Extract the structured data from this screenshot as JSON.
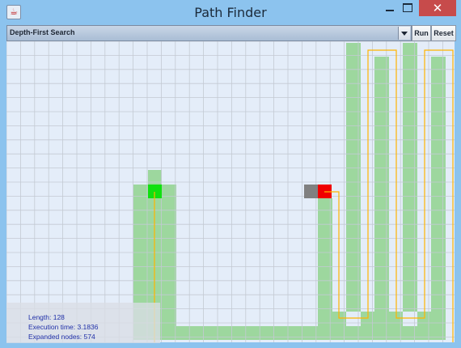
{
  "window": {
    "title": "Path Finder",
    "close_glyph": "✕"
  },
  "toolbar": {
    "algorithm_selected": "Depth-First Search",
    "run_label": "Run",
    "reset_label": "Reset"
  },
  "stats": {
    "length": "Length: 128",
    "execution_time": "Execution time: 3.1836",
    "expanded_nodes": "Expanded nodes: 574"
  },
  "colors": {
    "grid_background": "#e4edf9",
    "grid_line": "#c3cad3",
    "explored_cell": "#9dd79e",
    "start_cell": "#10e010",
    "goal_cell": "#f00000",
    "blocked_cell": "#808080",
    "path_line": "#ffb400"
  },
  "icons": {
    "app": "java-cup-icon",
    "minimize": "minimize-icon",
    "maximize": "maximize-icon",
    "close": "close-icon",
    "dropdown": "chevron-down-icon"
  }
}
